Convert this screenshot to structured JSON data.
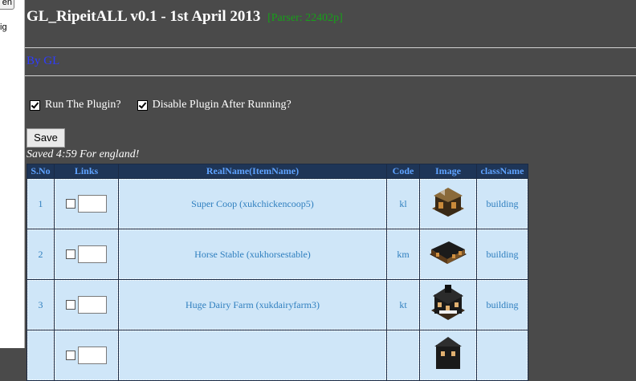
{
  "left_strip": {
    "button_fragment": "en",
    "text_fragment": "ig"
  },
  "header": {
    "title": "GL_RipeitALL v0.1 - 1st April 2013",
    "parser": "[Parser: 22402p]",
    "byline": "By GL"
  },
  "options": [
    {
      "label": "Run The Plugin?",
      "checked": true
    },
    {
      "label": "Disable Plugin After Running?",
      "checked": true
    }
  ],
  "save_label": "Save",
  "saved_message": "Saved 4:59 For england!",
  "table": {
    "headers": [
      "S.No",
      "Links",
      "RealName(ItemName)",
      "Code",
      "Image",
      "className"
    ],
    "rows": [
      {
        "sno": "1",
        "name": "Super Coop (xukchickencoop5)",
        "code": "kl",
        "class": "building",
        "image": "chicken-coop-icon"
      },
      {
        "sno": "2",
        "name": "Horse Stable (xukhorsestable)",
        "code": "km",
        "class": "building",
        "image": "horse-stable-icon"
      },
      {
        "sno": "3",
        "name": "Huge Dairy Farm (xukdairyfarm3)",
        "code": "kt",
        "class": "building",
        "image": "dairy-farm-icon"
      },
      {
        "sno": "",
        "name": "",
        "code": "",
        "class": "",
        "image": "building-icon"
      }
    ]
  }
}
